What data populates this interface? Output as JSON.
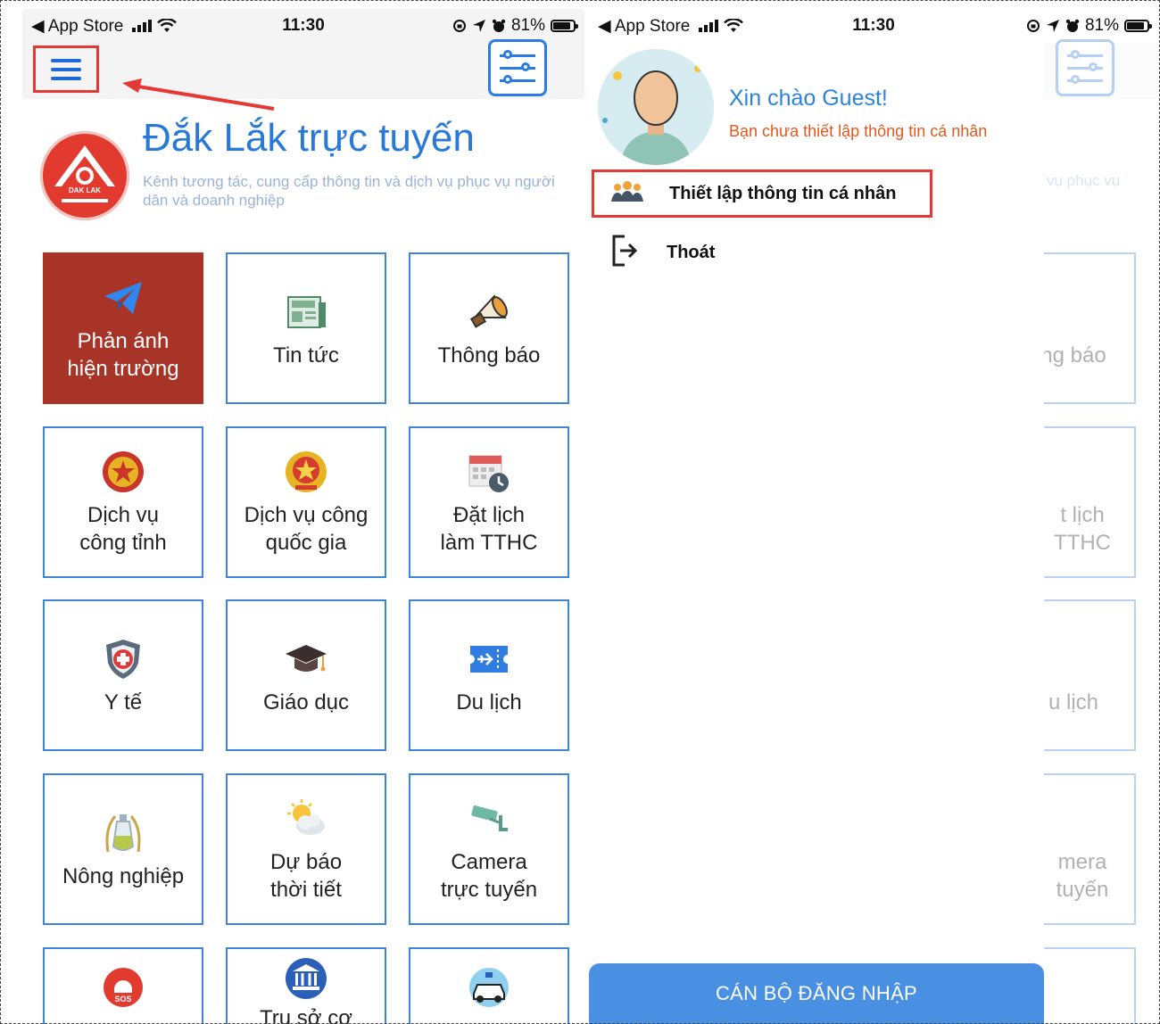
{
  "status_bar": {
    "carrier": "◀ App Store",
    "time": "11:30",
    "battery": "81%"
  },
  "left_screen": {
    "title": "Đắk Lắk trực tuyến",
    "subtitle": "Kênh tương tác, cung cấp thông tin và dịch vụ phục vụ người dân và doanh nghiệp",
    "logo_text": "DAK LAK",
    "tiles": [
      {
        "label": "Phản ánh\nhiện trường",
        "icon": "paper-plane-icon"
      },
      {
        "label": "Tin tức",
        "icon": "newspaper-icon"
      },
      {
        "label": "Thông báo",
        "icon": "megaphone-icon"
      },
      {
        "label": "Dịch vụ\ncông tỉnh",
        "icon": "provincial-emblem-icon"
      },
      {
        "label": "Dịch vụ công\nquốc gia",
        "icon": "national-emblem-icon"
      },
      {
        "label": "Đặt lịch\nlàm TTHC",
        "icon": "calendar-clock-icon"
      },
      {
        "label": "Y tế",
        "icon": "medical-shield-icon"
      },
      {
        "label": "Giáo dục",
        "icon": "graduation-cap-icon"
      },
      {
        "label": "Du lịch",
        "icon": "airplane-ticket-icon"
      },
      {
        "label": "Nông nghiệp",
        "icon": "agriculture-icon"
      },
      {
        "label": "Dự báo\nthời tiết",
        "icon": "weather-icon"
      },
      {
        "label": "Camera\ntrực tuyến",
        "icon": "cctv-camera-icon"
      },
      {
        "label": "",
        "icon": "sos-icon"
      },
      {
        "label": "Trụ sở cơ",
        "icon": "government-building-icon"
      },
      {
        "label": "",
        "icon": "police-car-icon"
      }
    ]
  },
  "right_screen": {
    "greeting": "Xin chào Guest!",
    "greeting_sub": "Bạn chưa thiết lập thông tin cá nhân",
    "menu": [
      {
        "label": "Thiết lập thông tin cá nhân",
        "icon": "users-icon"
      },
      {
        "label": "Thoát",
        "icon": "logout-icon"
      }
    ],
    "login_button": "CÁN BỘ ĐĂNG NHẬP",
    "underlay": {
      "subtitle_fragment": "vụ phục vụ",
      "tiles": [
        {
          "label": "ng báo"
        },
        {
          "label": "t lịch\nTTHC"
        },
        {
          "label": "u lịch"
        },
        {
          "label": "mera\ntuyến"
        },
        {
          "label": ""
        }
      ]
    }
  },
  "colors": {
    "accent": "#2979d9",
    "active_tile": "#a83327",
    "annotation": "#e53935",
    "login_button": "#4a90e2",
    "greeting_sub": "#e2581c"
  }
}
